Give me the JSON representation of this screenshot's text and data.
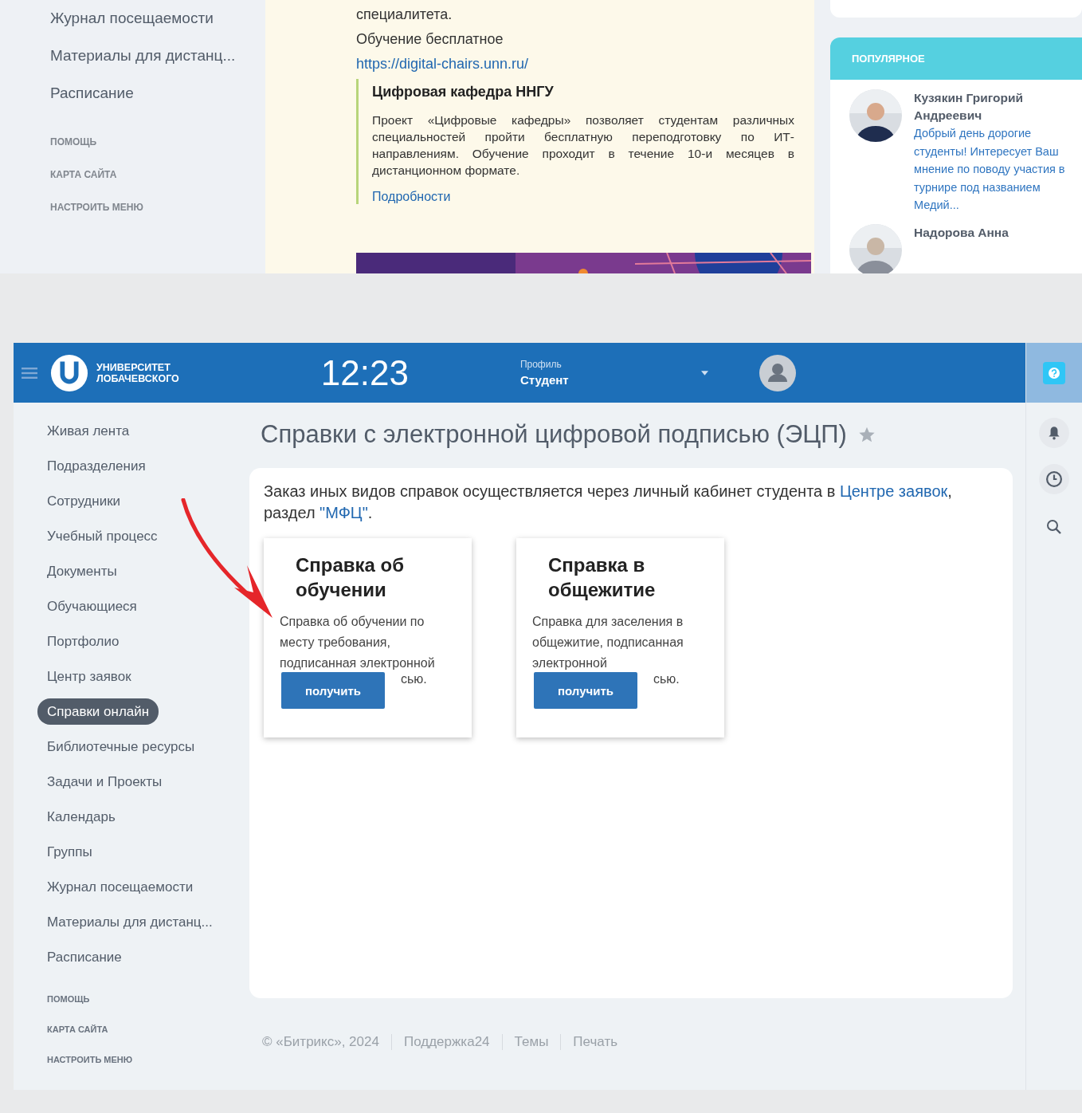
{
  "top_screen": {
    "sidebar": {
      "items": [
        {
          "label": "Журнал посещаемости"
        },
        {
          "label": "Материалы для дистанц..."
        },
        {
          "label": "Расписание"
        }
      ],
      "service_links": [
        "ПОМОЩЬ",
        "КАРТА САЙТА",
        "НАСТРОИТЬ МЕНЮ"
      ]
    },
    "post": {
      "lines": [
        "специалитета.",
        "Обучение бесплатное"
      ],
      "link": "https://digital-chairs.unn.ru/",
      "quote": {
        "title": "Цифровая кафедра ННГУ",
        "text": "Проект «Цифровые кафедры» позволяет студентам различных специальностей пройти бесплатную переподготовку по ИТ-направлениям. Обучение проходит в течение 10-и месяцев в дистанционном формате.",
        "more": "Подробности"
      }
    },
    "popular": {
      "title": "ПОПУЛЯРНОЕ",
      "items": [
        {
          "name": "Кузякин Григорий Андреевич",
          "text": "Добрый день дорогие студенты! Интересует Ваш мнение по поводу участия в турнире под названием Медий..."
        },
        {
          "name": "Надорова Анна"
        }
      ]
    }
  },
  "bottom_screen": {
    "header": {
      "logo": [
        "УНИВЕРСИТЕТ",
        "ЛОБАЧЕВСКОГО"
      ],
      "time": "12:23",
      "profile_label": "Профиль",
      "profile_value": "Студент"
    },
    "sidebar": {
      "items": [
        {
          "label": "Живая лента",
          "selected": false
        },
        {
          "label": "Подразделения",
          "selected": false
        },
        {
          "label": "Сотрудники",
          "selected": false
        },
        {
          "label": "Учебный процесс",
          "selected": false
        },
        {
          "label": "Документы",
          "selected": false
        },
        {
          "label": "Обучающиеся",
          "selected": false
        },
        {
          "label": "Портфолио",
          "selected": false
        },
        {
          "label": "Центр заявок",
          "selected": false
        },
        {
          "label": "Справки онлайн",
          "selected": true
        },
        {
          "label": "Библиотечные ресурсы",
          "selected": false
        },
        {
          "label": "Задачи и Проекты",
          "selected": false
        },
        {
          "label": "Календарь",
          "selected": false
        },
        {
          "label": "Группы",
          "selected": false
        },
        {
          "label": "Журнал посещаемости",
          "selected": false
        },
        {
          "label": "Материалы для дистанц...",
          "selected": false
        },
        {
          "label": "Расписание",
          "selected": false
        }
      ],
      "service_links": [
        "ПОМОЩЬ",
        "КАРТА САЙТА",
        "НАСТРОИТЬ МЕНЮ"
      ]
    },
    "page_title": "Справки с электронной цифровой подписью (ЭЦП)",
    "notice": {
      "parts": [
        {
          "kind": "text",
          "text": "Заказ иных видов справок осуществляется через личный кабинет студента в "
        },
        {
          "kind": "link",
          "text": "Центре заявок"
        },
        {
          "kind": "text",
          "text": ", раздел "
        },
        {
          "kind": "link",
          "text": "\"МФЦ\""
        },
        {
          "kind": "text",
          "text": "."
        }
      ]
    },
    "cards": [
      {
        "title": "Справка об обучении",
        "description": "Справка об обучении по месту требования, подписанная электронной",
        "description_tail": "сью.",
        "button": "получить"
      },
      {
        "title": "Справка в общежитие",
        "description": "Справка для заселения в общежитие, подписанная электронной",
        "description_tail": "сью.",
        "button": "получить"
      }
    ],
    "footer": [
      "© «Битрикс», 2024",
      "Поддержка24",
      "Темы",
      "Печать"
    ]
  }
}
